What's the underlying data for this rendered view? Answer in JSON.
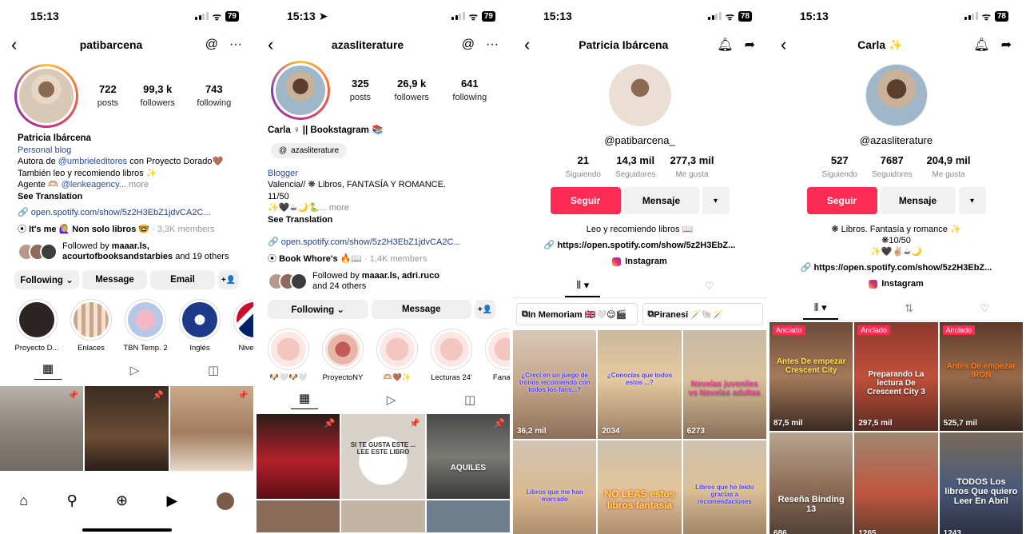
{
  "status": {
    "p1": {
      "time": "15:13",
      "battery": "79"
    },
    "p2": {
      "time": "15:13",
      "battery": "79"
    },
    "p3": {
      "time": "15:13",
      "battery": "78"
    },
    "p4": {
      "time": "15:13",
      "battery": "78"
    }
  },
  "ig1": {
    "username": "patibarcena",
    "stats": [
      {
        "value": "722",
        "label": "posts"
      },
      {
        "value": "99,3 k",
        "label": "followers"
      },
      {
        "value": "743",
        "label": "following"
      }
    ],
    "name": "Patricia Ibárcena",
    "category": "Personal blog",
    "bio_line1_prefix": "Autora de ",
    "bio_line1_mention": "@umbrieleditores",
    "bio_line1_suffix": " con Proyecto Dorado🤎",
    "bio_line2": "También leo y recomiendo libros ✨",
    "bio_line3_prefix": "Agente 🫶🏼 ",
    "bio_line3_mention": "@lenkeagency...",
    "bio_more": " more",
    "see_translation": "See Translation",
    "link": "open.spotify.com/show/5z2H3EbZ1jdvCA2C...",
    "group_prefix": "It's me 🙋🏼‍♀️ Non solo libros 🤓",
    "group_members": " · 3,3K members",
    "followed_by_prefix": "Followed by ",
    "followed_by_names": "maaar.ls, acourtofbooksandstarbies",
    "followed_by_suffix": " and 19 others",
    "buttons": {
      "following": "Following ⌄",
      "message": "Message",
      "email": "Email",
      "add": "+👤"
    },
    "highlights": [
      "Proyecto D...",
      "Enlaces",
      "TBN Temp. 2",
      "Inglés",
      "Nivel de i"
    ],
    "nav": [
      "⌂",
      "⚲",
      "⊕",
      "▶",
      ""
    ]
  },
  "ig2": {
    "username": "azasliterature",
    "stats": [
      {
        "value": "325",
        "label": "posts"
      },
      {
        "value": "26,9 k",
        "label": "followers"
      },
      {
        "value": "641",
        "label": "following"
      }
    ],
    "name": "Carla ♀ || Bookstagram 📚",
    "threads": "azasliterature",
    "category": "Blogger",
    "bio_line1": "Valencia// ❋ Libros, FANTASÍA Y ROMANCE.",
    "bio_line2": "11/50",
    "bio_line3": "✨🖤☕🌙🐍",
    "bio_more": "... more",
    "see_translation": "See Translation",
    "link": "open.spotify.com/show/5z2H3EbZ1jdvCA2C...",
    "group_prefix": "Book Whore's 🔥📖",
    "group_members": " · 1,4K members",
    "followed_by_prefix": "Followed by ",
    "followed_by_names": "maaar.ls, adri.ruco",
    "followed_by_suffix": "and 24 others",
    "buttons": {
      "following": "Following ⌄",
      "message": "Message",
      "add": "+👤"
    },
    "highlights": [
      "🐶🤍🐶🤍",
      "ProyectoNY",
      "🫶🏼🤎✨",
      "Lecturas 24'",
      "Fanarts"
    ],
    "post_texts": [
      "",
      "SI TE GUSTA ESTE ... LEE ESTE LIBRO",
      "AQUILES"
    ]
  },
  "tt1": {
    "title": "Patricia Ibárcena",
    "handle": "@patibarcena_",
    "stats": [
      {
        "value": "21",
        "label": "Siguiendo"
      },
      {
        "value": "14,3 mil",
        "label": "Seguidores"
      },
      {
        "value": "277,3 mil",
        "label": "Me gusta"
      }
    ],
    "buttons": {
      "follow": "Seguir",
      "message": "Mensaje",
      "more": "▾"
    },
    "bio": "Leo y recomiendo libros 📖",
    "link": "https://open.spotify.com/show/5z2H3EbZ...",
    "instagram": "Instagram",
    "playlists": [
      "In Memoriam 🇬🇧🤍😌🎬",
      "Piranesi 🪄🐚🪄"
    ],
    "videos": [
      {
        "text": "¿Crecí en un juego de tronos recomiendo con todos los fans...?",
        "views": "36,2 mil"
      },
      {
        "text": "¿Conocías que todos estos ...?",
        "views": "2034"
      },
      {
        "text": "Novelas juveniles vs Novelas adultas",
        "views": "6273"
      },
      {
        "text": "Libros que me han marcado",
        "views": ""
      },
      {
        "text": "NO LEAS estos libros fantasía",
        "views": ""
      },
      {
        "text": "Libros que he leído gracias a recomendaciones",
        "views": ""
      }
    ]
  },
  "tt2": {
    "title": "Carla ✨",
    "handle": "@azasliterature",
    "stats": [
      {
        "value": "527",
        "label": "Siguiendo"
      },
      {
        "value": "7687",
        "label": "Seguidores"
      },
      {
        "value": "204,9 mil",
        "label": "Me gusta"
      }
    ],
    "buttons": {
      "follow": "Seguir",
      "message": "Mensaje",
      "more": "▾"
    },
    "bio_line1": "❋ Libros. Fantasía y romance ✨",
    "bio_line2": "❋10/50",
    "bio_line3": "✨🖤✌🏼☕🌙",
    "link": "https://open.spotify.com/show/5z2H3EbZ...",
    "instagram": "Instagram",
    "pinned_label": "Anclado",
    "videos": [
      {
        "text": "Antes De empezar Crescent City",
        "views": "87,5 mil",
        "pinned": true
      },
      {
        "text": "Preparando La lectura De Crescent City 3",
        "views": "297,5 mil",
        "pinned": true
      },
      {
        "text": "Antes De empezar IRON",
        "views": "525,7 mil",
        "pinned": true
      },
      {
        "text": "Reseña Binding 13",
        "views": "686",
        "pinned": false
      },
      {
        "text": "",
        "views": "1265",
        "pinned": false
      },
      {
        "text": "TODOS Los libros Que quiero Leer En Abril",
        "views": "1243",
        "pinned": false
      }
    ]
  }
}
